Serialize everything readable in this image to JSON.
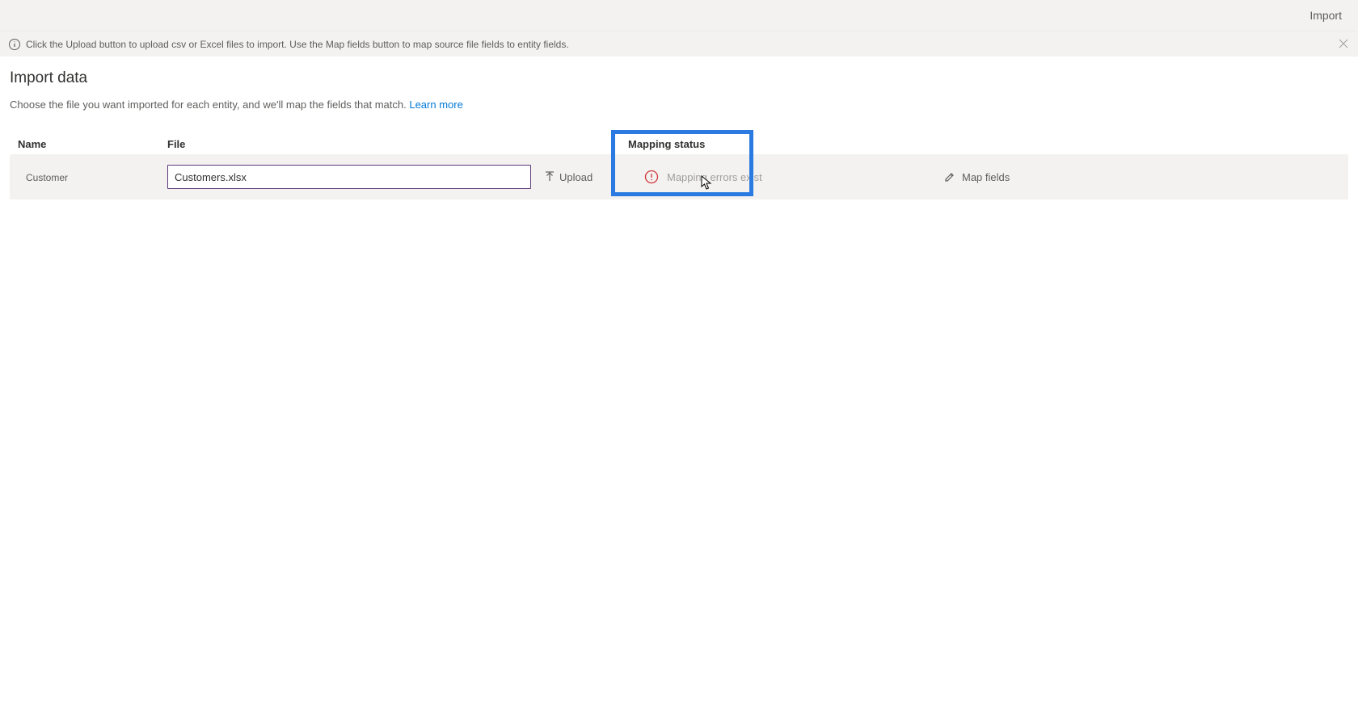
{
  "topbar": {
    "import_label": "Import"
  },
  "info_banner": {
    "text": "Click the Upload button to upload csv or Excel files to import. Use the Map fields button to map source file fields to entity fields."
  },
  "page": {
    "title": "Import data",
    "description": "Choose the file you want imported for each entity, and we'll map the fields that match. ",
    "learn_more": "Learn more"
  },
  "grid": {
    "headers": {
      "name": "Name",
      "file": "File",
      "status": "Mapping status"
    },
    "row": {
      "entity": "Customer",
      "filename": "Customers.xlsx",
      "upload_label": "Upload",
      "status_text": "Mapping errors exist",
      "map_fields_label": "Map fields"
    }
  }
}
